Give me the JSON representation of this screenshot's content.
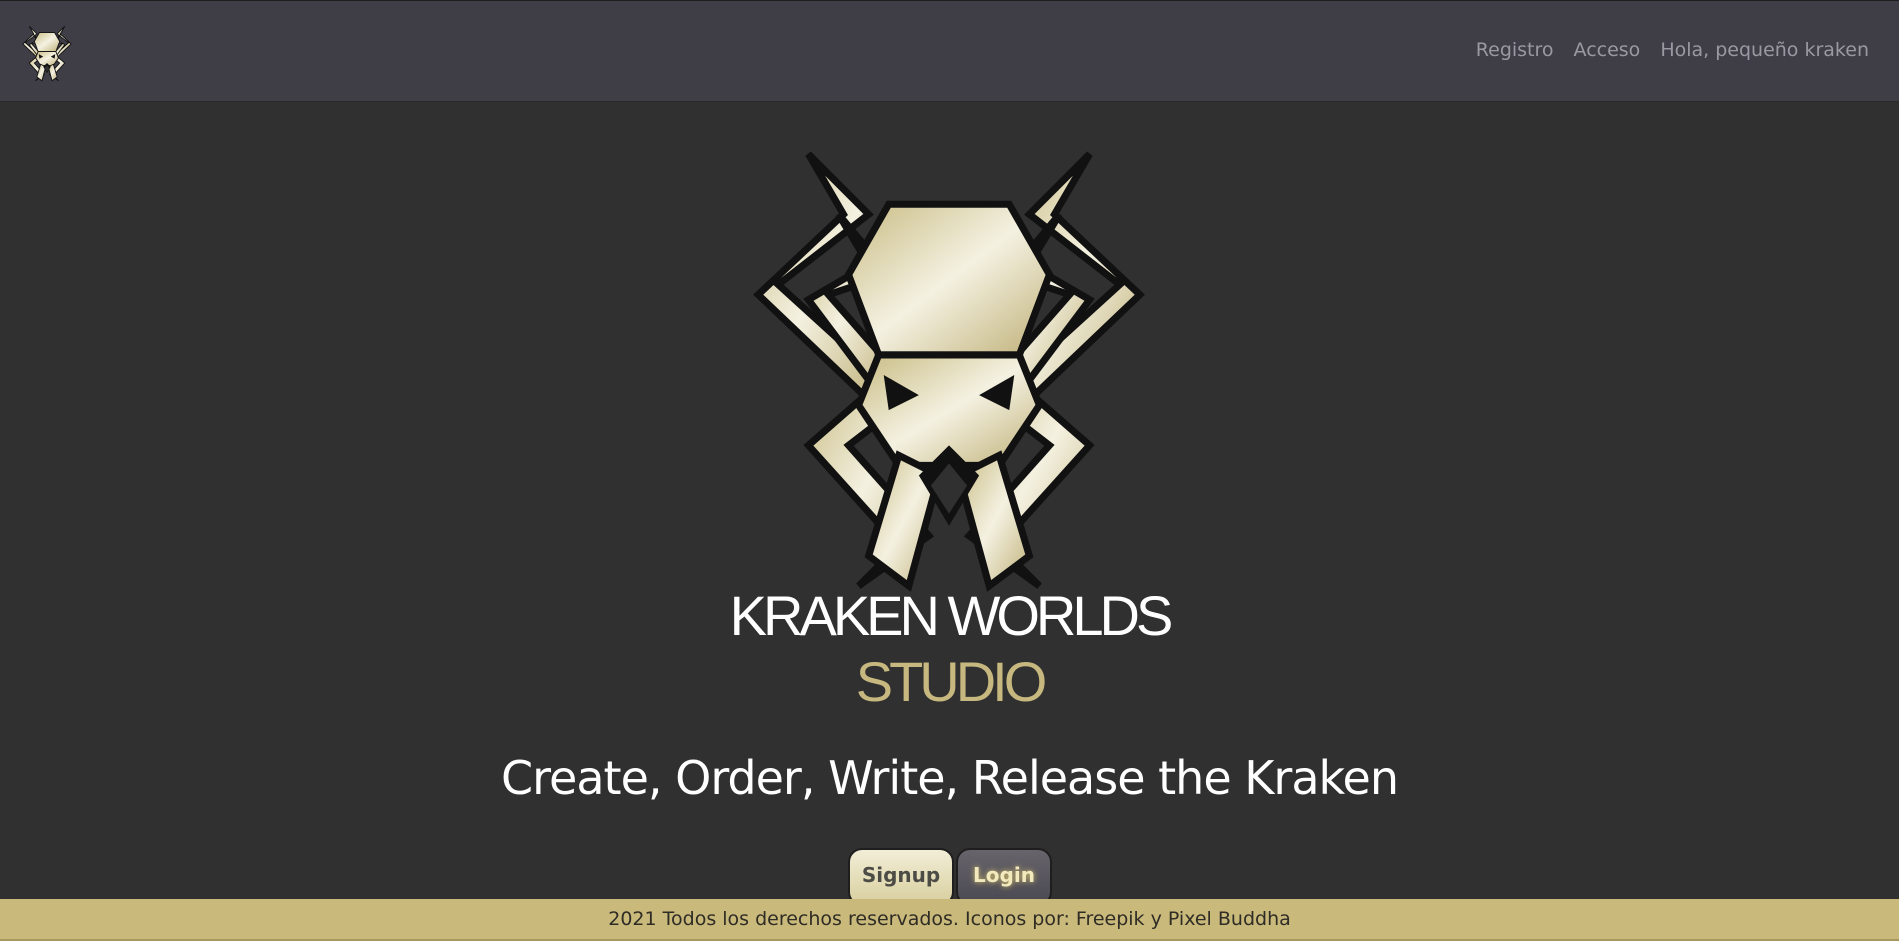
{
  "navbar": {
    "logo_icon": "kraken-logo-icon",
    "links": [
      "Registro",
      "Acceso",
      "Hola, pequeño kraken"
    ]
  },
  "hero": {
    "logo_icon": "kraken-logo-icon",
    "title_line1": "KRAKEN WORLDS",
    "title_line2": "STUDIO",
    "tagline": "Create, Order, Write, Release the Kraken"
  },
  "buttons": {
    "signup_label": "Signup",
    "login_label": "Login"
  },
  "footer": {
    "text": "2021 Todos los derechos reservados. Iconos por: Freepik y Pixel Buddha"
  },
  "colors": {
    "background": "#303030",
    "navbar": "#3f3d46",
    "gold": "#c9b97b",
    "gold_light": "#f2eed7"
  }
}
